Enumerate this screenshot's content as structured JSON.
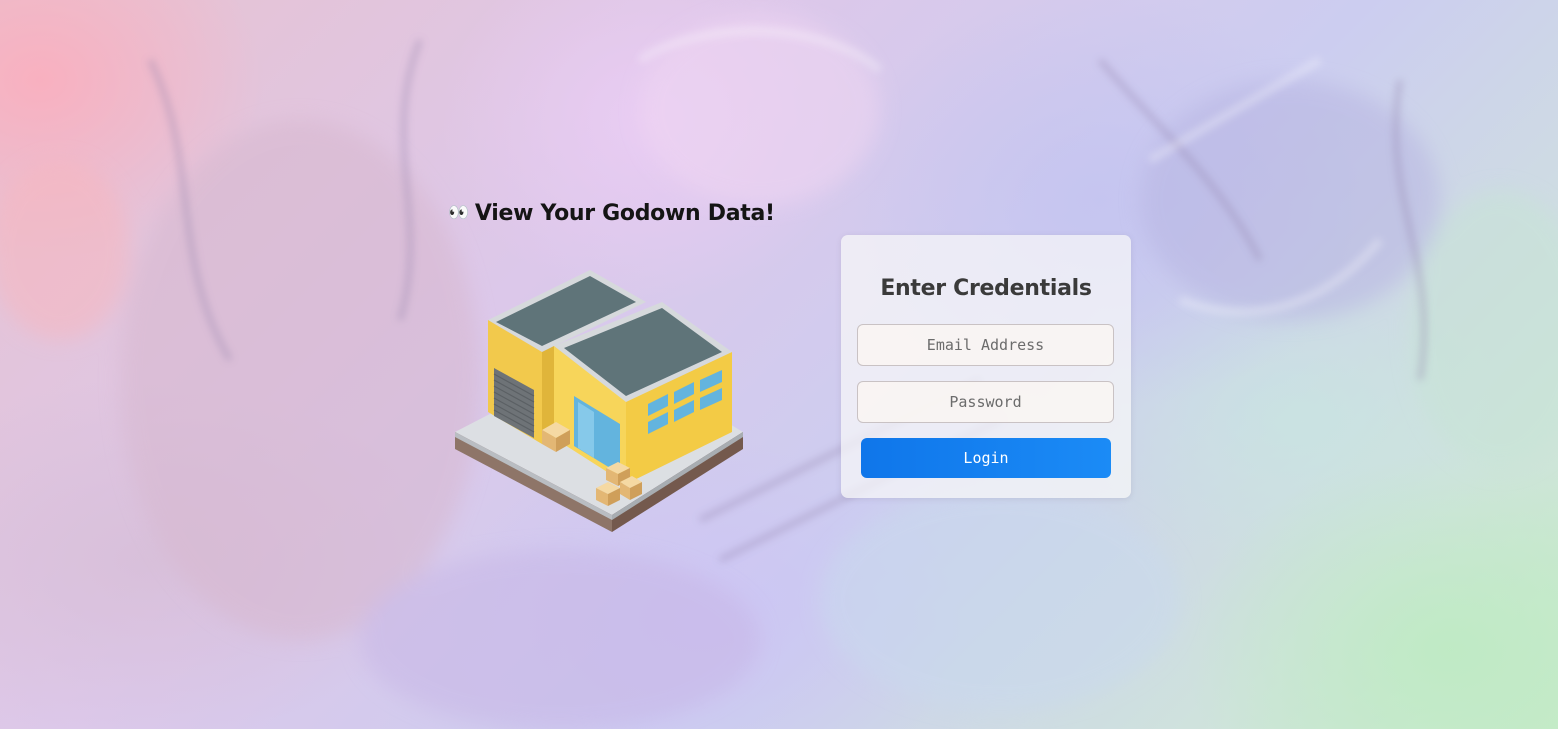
{
  "page": {
    "headline": "View Your Godown Data!",
    "headline_emoji": "👀"
  },
  "illustration": {
    "icon": "warehouse-icon"
  },
  "login": {
    "title": "Enter Credentials",
    "email_placeholder": "Email Address",
    "password_placeholder": "Password",
    "button_label": "Login"
  },
  "colors": {
    "button": "#1480f0",
    "card_background": "#f8f8f8",
    "heading_text": "#141414"
  }
}
